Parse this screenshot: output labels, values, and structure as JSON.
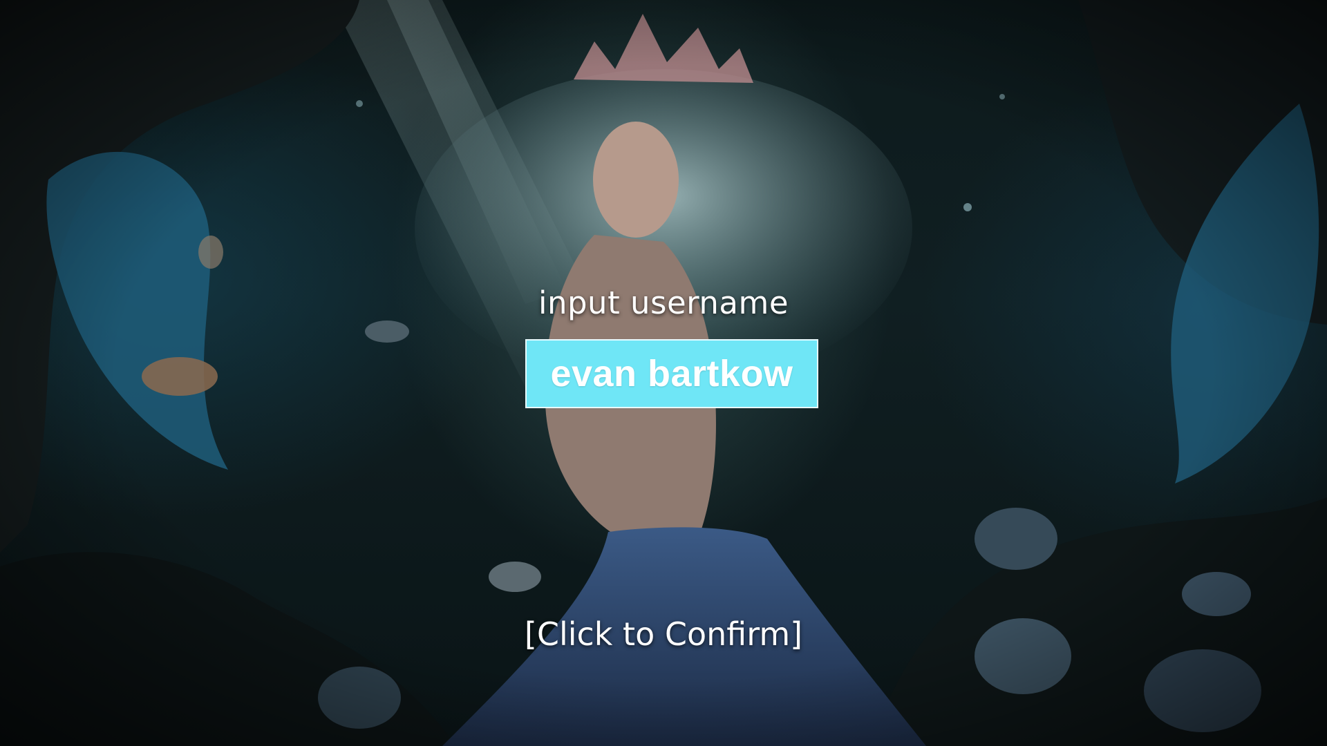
{
  "login": {
    "prompt": "input username",
    "username_value": "evan bartkow",
    "confirm_label": "[Click to Confirm]"
  },
  "colors": {
    "field_background": "#6fe6f6",
    "field_border": "#e8fbff",
    "text": "#ffffff"
  },
  "background": {
    "scene": "underwater mermaid artwork"
  }
}
